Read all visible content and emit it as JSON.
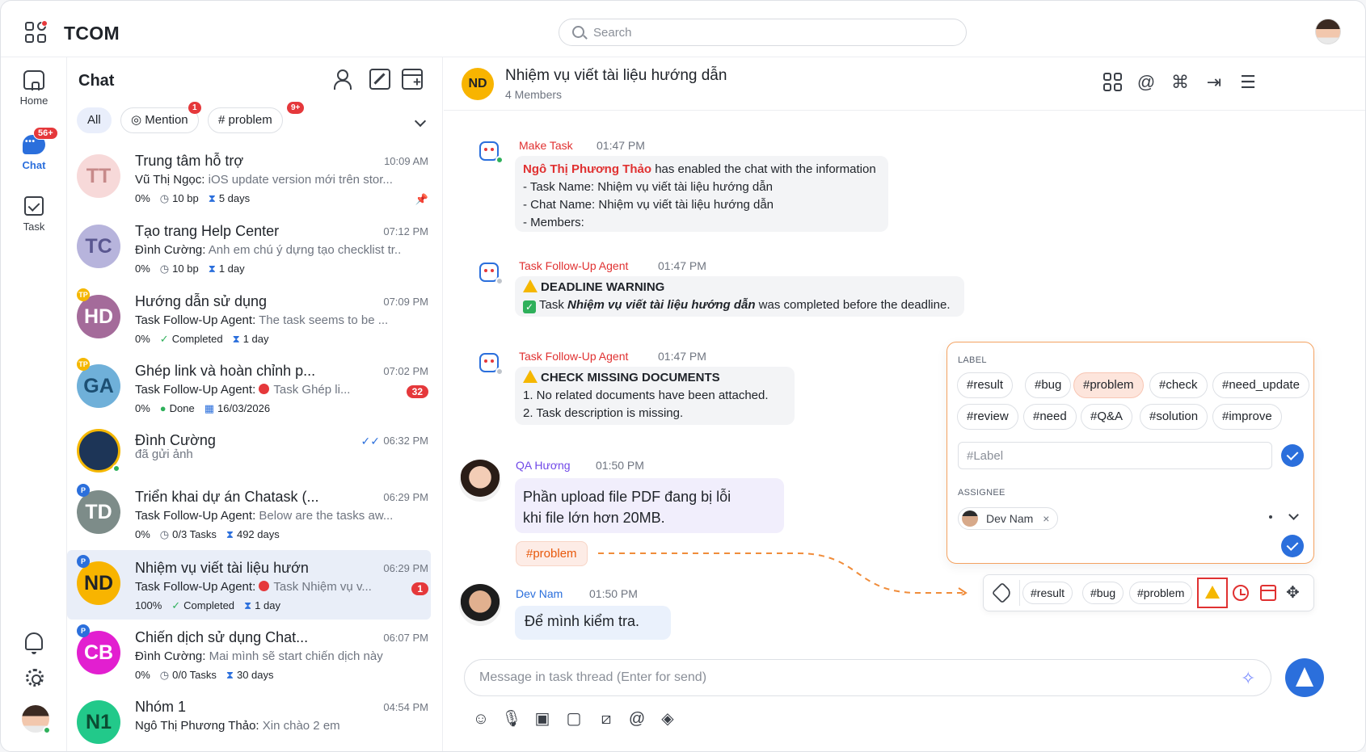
{
  "app": {
    "brand": "TCOM"
  },
  "search": {
    "placeholder": "Search"
  },
  "rail": {
    "home": "Home",
    "chat": "Chat",
    "chat_badge": "56+",
    "task": "Task"
  },
  "chatlist": {
    "title": "Chat",
    "filters": {
      "all": "All",
      "mention": "Mention",
      "mention_badge": "1",
      "problem": "# problem",
      "problem_badge": "9+"
    },
    "rows": [
      {
        "initials": "TT",
        "name": "Trung tâm hỗ trợ",
        "time": "10:09 AM",
        "sender": "Vũ Thị Ngọc:",
        "msg": "iOS update version mới trên stor...",
        "progress": "0%",
        "m1": "10 bp",
        "m2": "5 days",
        "color": "#f7d9d9",
        "text_color": "#c78a8a"
      },
      {
        "initials": "TC",
        "name": "Tạo trang Help Center",
        "time": "07:12 PM",
        "sender": "Đình Cường:",
        "msg": "Anh em chú ý dựng tạo checklist tr...",
        "progress": "0%",
        "m1": "10 bp",
        "m2": "1 day",
        "color": "#b7b4dc",
        "text_color": "#5a5790"
      },
      {
        "initials": "HD",
        "corner": "TP",
        "name": "Hướng dẫn sử dụng",
        "time": "07:09 PM",
        "sender": "Task Follow-Up Agent:",
        "msg": "The task seems to be ...",
        "progress": "0%",
        "m1": "Completed",
        "m2": "1 day",
        "color": "#a46b9a",
        "text_color": "#ffffff"
      },
      {
        "initials": "GA",
        "corner": "TP",
        "name": "Ghép link và hoàn chỉnh p...",
        "time": "07:02 PM",
        "sender": "Task Follow-Up Agent:",
        "msg": "Task Ghép li...",
        "progress": "0%",
        "m1": "Done",
        "m2": "16/03/2026",
        "count": "32",
        "color": "#6fb0d9",
        "text_color": "#1c4f73"
      },
      {
        "initials": "",
        "name": "Đình Cường",
        "time": "06:32 PM",
        "sender": "",
        "msg": "đã gửi ảnh",
        "color": "#1d3557",
        "text_color": "#f5b700"
      },
      {
        "initials": "TD",
        "corner": "P",
        "name": "Triển khai dự án Chatask (...",
        "time": "06:29 PM",
        "sender": "Task Follow-Up Agent:",
        "msg": "Below are the tasks aw...",
        "progress": "0%",
        "m1": "0/3 Tasks",
        "m2": "492 days",
        "color": "#7d8c89",
        "text_color": "#ffffff"
      },
      {
        "initials": "ND",
        "corner": "P",
        "name": "Nhiệm vụ viết tài liệu hướn",
        "time": "06:29 PM",
        "sender": "Task Follow-Up Agent:",
        "msg": "Task Nhiệm vụ v...",
        "progress": "100%",
        "m1": "Completed",
        "m2": "1 day",
        "count": "1",
        "color": "#f8b400",
        "text_color": "#1f2329"
      },
      {
        "initials": "CB",
        "corner": "P",
        "name": "Chiến dịch sử dụng Chat...",
        "time": "06:07 PM",
        "sender": "Đình Cường:",
        "msg": "Mai mình sẽ start chiến dịch này",
        "progress": "0%",
        "m1": "0/0 Tasks",
        "m2": "30 days",
        "color": "#e21fd0",
        "text_color": "#ffffff"
      },
      {
        "initials": "N1",
        "name": "Nhóm 1",
        "time": "04:54 PM",
        "sender": "Ngô Thị Phương Thảo:",
        "msg": "Xin chào 2 em",
        "color": "#22c98a",
        "text_color": "#0b4d33"
      }
    ]
  },
  "conversation": {
    "avatar": "ND",
    "title": "Nhiệm vụ viết tài liệu hướng dẫn",
    "subtitle": "4 Members",
    "messages": {
      "m1": {
        "sender": "Make Task",
        "time": "01:47 PM",
        "name": "Ngô Thị Phương Thảo",
        "line0": "has enabled the chat with the information",
        "line1": "- Task Name: Nhiệm vụ viết tài liệu hướng dẫn",
        "line2": "- Chat Name: Nhiệm vụ viết tài liệu hướng dẫn",
        "line3": "- Members:"
      },
      "m2": {
        "sender": "Task Follow-Up Agent",
        "time": "01:47 PM",
        "heading": "DEADLINE WARNING",
        "pre": "Task",
        "task": "Nhiệm vụ viết tài liệu hướng dẫn",
        "post": "was completed before the deadline."
      },
      "m3": {
        "sender": "Task Follow-Up Agent",
        "time": "01:47 PM",
        "heading": "CHECK MISSING DOCUMENTS",
        "line1": "1. No related documents have been attached.",
        "line2": "2. Task description is missing."
      },
      "m4": {
        "sender": "QA Hương",
        "time": "01:50 PM",
        "line1": "Phần upload file PDF đang bị lỗi",
        "line2": "khi file lớn hơn 20MB.",
        "tag": "#problem"
      },
      "m5": {
        "sender": "Dev Nam",
        "time": "01:50 PM",
        "text": "Để mình kiểm tra."
      }
    }
  },
  "label_card": {
    "label_heading": "LABEL",
    "labels": [
      "#result",
      "#bug",
      "#problem",
      "#check",
      "#need_update",
      "#review",
      "#need",
      "#Q&A",
      "#solution",
      "#improve"
    ],
    "selected": "#problem",
    "input_placeholder": "#Label",
    "assignee_heading": "ASSIGNEE",
    "assignee": "Dev Nam",
    "remove": "×"
  },
  "toolbar": {
    "chips": [
      "#result",
      "#bug",
      "#problem"
    ]
  },
  "composer": {
    "placeholder": "Message in task thread (Enter for send)"
  },
  "colors": {
    "accent": "#2b6fdc",
    "danger": "#e03131",
    "warning": "#f5b700",
    "tag": "#e8590c"
  }
}
